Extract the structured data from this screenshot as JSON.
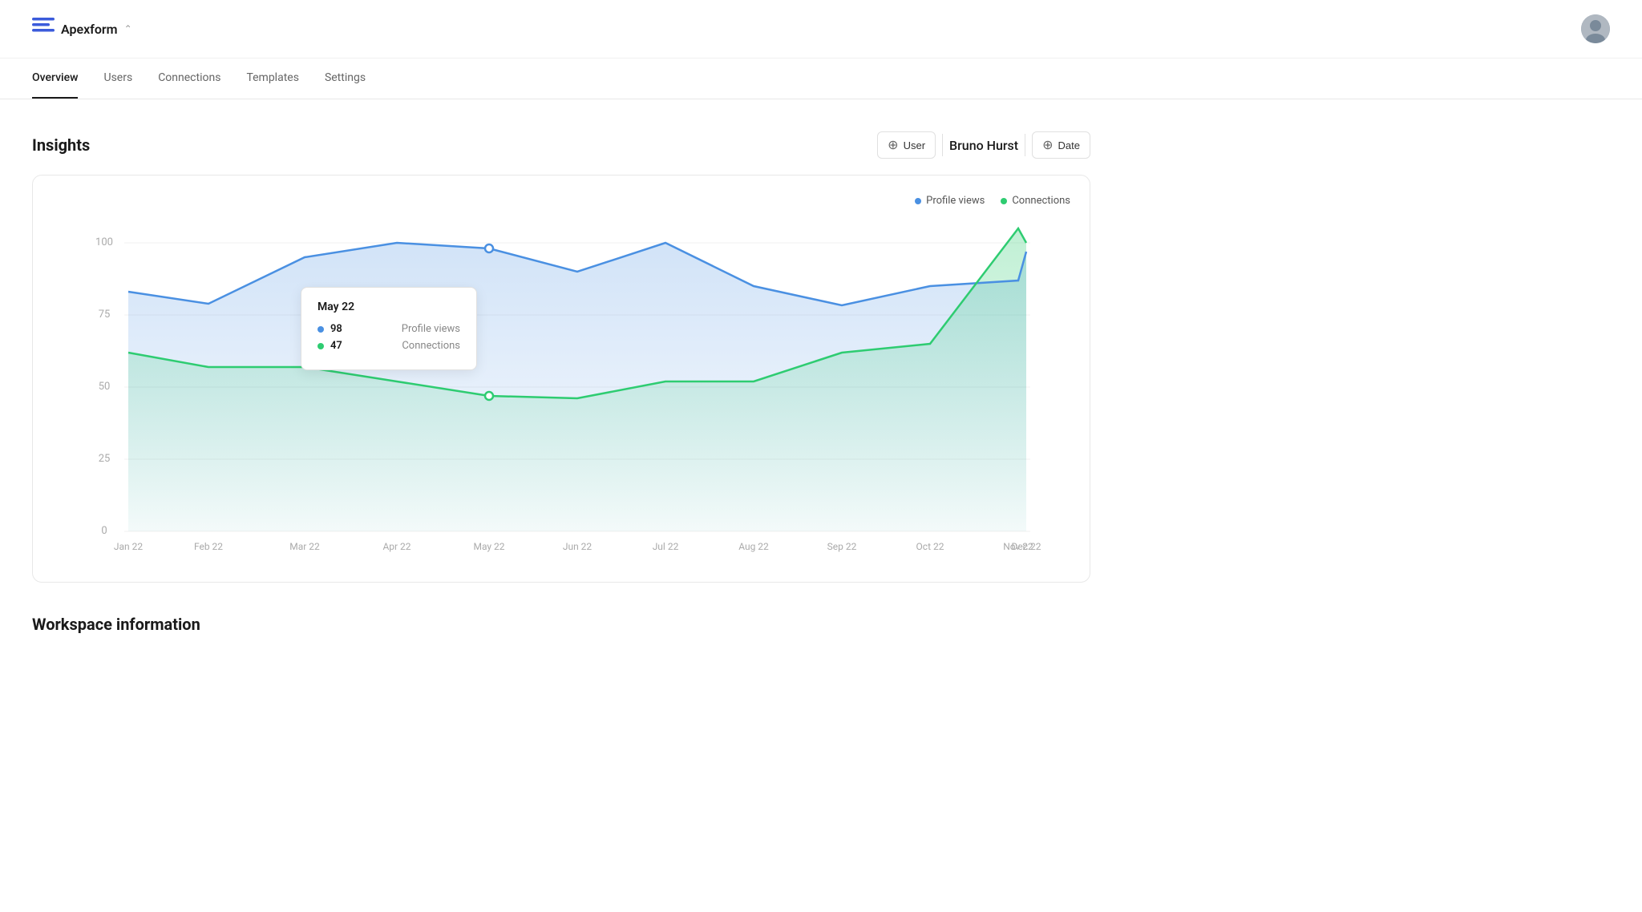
{
  "app": {
    "name": "Apexform",
    "logo_icon": "≡",
    "chevron": "⌃"
  },
  "nav": {
    "items": [
      {
        "label": "Overview",
        "active": true
      },
      {
        "label": "Users",
        "active": false
      },
      {
        "label": "Connections",
        "active": false
      },
      {
        "label": "Templates",
        "active": false
      },
      {
        "label": "Settings",
        "active": false
      }
    ]
  },
  "insights": {
    "title": "Insights",
    "filters": {
      "user_label": "User",
      "user_value": "Bruno Hurst",
      "date_label": "Date"
    },
    "legend": {
      "profile_views": "Profile views",
      "connections": "Connections"
    },
    "tooltip": {
      "date": "May 22",
      "profile_views_value": "98",
      "profile_views_label": "Profile views",
      "connections_value": "47",
      "connections_label": "Connections"
    },
    "y_axis": [
      "100",
      "75",
      "50",
      "25",
      "0"
    ],
    "x_axis": [
      "Jan 22",
      "Feb 22",
      "Mar 22",
      "Apr 22",
      "May 22",
      "Jun 22",
      "Jul 22",
      "Aug 22",
      "Sep 22",
      "Oct 22",
      "Nov 22",
      "Dec 22"
    ]
  },
  "workspace": {
    "title": "Workspace information"
  }
}
